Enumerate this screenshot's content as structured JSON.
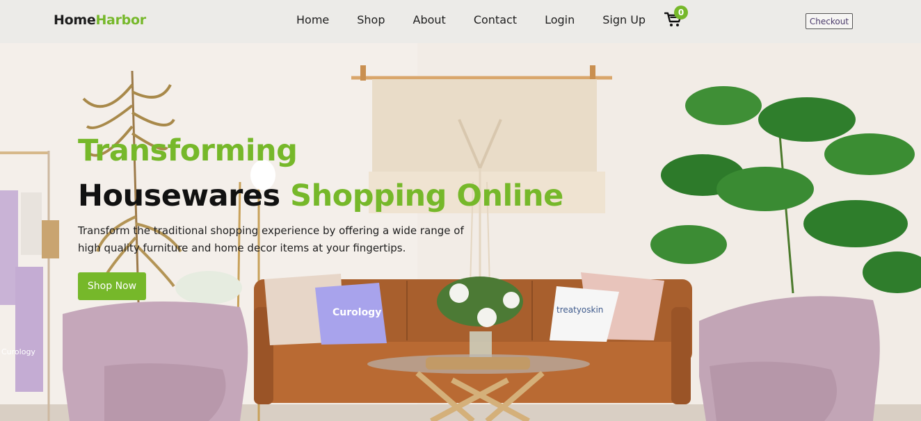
{
  "header": {
    "logo_part1": "Home",
    "logo_part2": "Harbor",
    "nav": [
      "Home",
      "Shop",
      "About",
      "Contact",
      "Login",
      "Sign Up"
    ],
    "cart_count": "0",
    "cart_icon": "shopping-cart-icon",
    "checkout_label": "Checkout"
  },
  "hero": {
    "title_line1": "Transforming",
    "title_line2_dark": "Housewares",
    "title_line2_green": "Shopping Online",
    "subtitle_line1": "Transform the traditional shopping experience by offering a wide range of",
    "subtitle_line2": "high quality furniture and home decor items at your fingertips.",
    "cta_label": "Shop Now",
    "pillow_left_text": "Curology",
    "pillow_right_text": "treatyoskin",
    "towel_text": "Curology"
  },
  "colors": {
    "accent": "#76b82a",
    "header_bg": "#ecebe8",
    "text_dark": "#111111"
  }
}
